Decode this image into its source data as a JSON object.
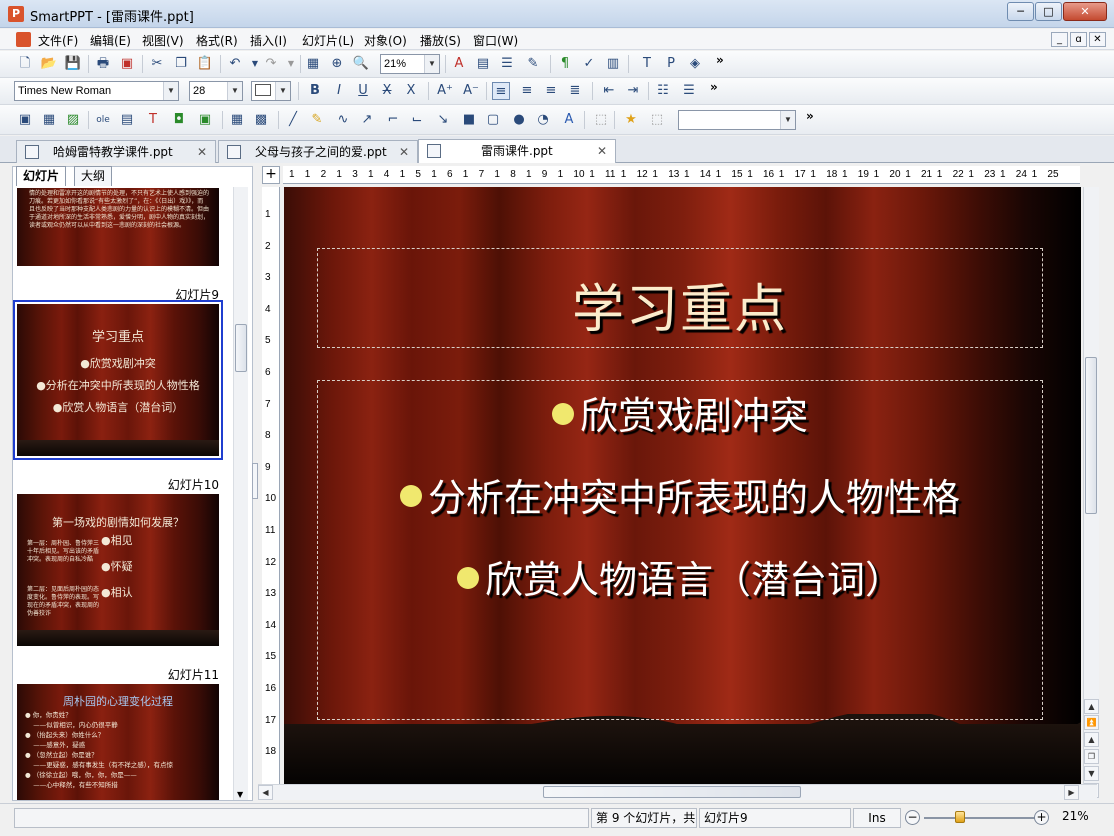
{
  "window": {
    "title": "SmartPPT - [雷雨课件.ppt]",
    "app_icon": "P",
    "minimize": "─",
    "maximize": "□",
    "close": "✕"
  },
  "menu": [
    "文件(F)",
    "编辑(E)",
    "视图(V)",
    "格式(R)",
    "插入(I)",
    "幻灯片(L)",
    "对象(O)",
    "播放(S)",
    "窗口(W)"
  ],
  "mdi_buttons": [
    "_",
    "ɑ",
    "✕"
  ],
  "toolbar1": {
    "zoom": "21%",
    "overflow": "»"
  },
  "toolbar2": {
    "font": "Times New Roman",
    "size": "28",
    "overflow": "»"
  },
  "toolbar3": {
    "style_combo": "",
    "overflow": "»"
  },
  "doc_tabs": [
    {
      "label": "哈姆雷特教学课件.ppt",
      "active": false
    },
    {
      "label": "父母与孩子之间的爱.ppt",
      "active": false
    },
    {
      "label": "雷雨课件.ppt",
      "active": true
    }
  ],
  "panel_tabs": {
    "slides": "幻灯片",
    "outline": "大纲"
  },
  "thumbnails": {
    "slide8_text": "…对题情节上面让情是这的，这样面和更为明显。例如以往都来，去情的处理和雷凉开这的剧情节的处理，不只有艺术上使人感到强迫的刀痕。若更加如你看那说“有些太激烈了”，在：《（日出）戏》》，而且也反映了当时那种支配人类悲剧的力量的认识上的模糊不清。但由于通道对地所深的生活非常熟悉，爱憎分明，剧中人物的真实刻划，读者或观众仍然可以从中看到这一悲剧的深刻的社会根源。",
    "slide9_label": "幻灯片9",
    "slide9_title": "学习重点",
    "slide9_b1": "●欣赏戏剧冲突",
    "slide9_b2": "●分析在冲突中所表现的人物性格",
    "slide9_b3": "●欣赏人物语言（潜台词）",
    "slide10_label": "幻灯片10",
    "slide10_title": "第一场戏的剧情如何发展？",
    "slide10_b1": "●相见",
    "slide10_b2": "●怀疑",
    "slide10_b3": "●相认",
    "slide10_note1": "第一层：周朴园、鲁侍萍三十年后相见。写出该的矛盾冲突。表现周的自私冷酷",
    "slide10_note2": "第二层：见面后周朴园的态度变化。鲁侍萍的表现。写现在的矛盾冲突，表现周的伪善狡诈",
    "slide11_label": "幻灯片11",
    "slide11_title": "周朴园的心理变化过程",
    "slide11_lines": [
      "● 你，你贵姓？",
      "    ——似曾相识，内心仍很平静",
      "● （抬起头来）你姓什么？",
      "    ——感意外，疑惑",
      "● （忽然立起）你是谁？",
      "    ——更疑惑，感有事发生（有不祥之感），有点惊",
      "● （徐徐立起）哦，你，你，你是——",
      "    ——心中释然，有些不知所措"
    ]
  },
  "ruler": {
    "h": [
      "1",
      "1",
      "2",
      "1",
      "3",
      "1",
      "4",
      "1",
      "5",
      "1",
      "6",
      "1",
      "7",
      "1",
      "8",
      "1",
      "9",
      "1",
      "10",
      "1",
      "11",
      "1",
      "12",
      "1",
      "13",
      "1",
      "14",
      "1",
      "15",
      "1",
      "16",
      "1",
      "17",
      "1",
      "18",
      "1",
      "19",
      "1",
      "20",
      "1",
      "21",
      "1",
      "22",
      "1",
      "23",
      "1",
      "24",
      "1",
      "25"
    ],
    "v": [
      "1",
      "2",
      "3",
      "4",
      "5",
      "6",
      "7",
      "8",
      "9",
      "10",
      "11",
      "12",
      "13",
      "14",
      "15",
      "16",
      "17",
      "18"
    ]
  },
  "slide": {
    "title": "学习重点",
    "bullets": [
      "欣赏戏剧冲突",
      "分析在冲突中所表现的人物性格",
      "欣赏人物语言（潜台词）"
    ],
    "bullet_color": "#f0e86e",
    "background_color": "#7a1c0c"
  },
  "statusbar": {
    "position": "第 9 个幻灯片，共",
    "slide_name": "幻灯片9",
    "mode": "Ins",
    "zoom": "21%",
    "zoom_level": 0.21
  }
}
